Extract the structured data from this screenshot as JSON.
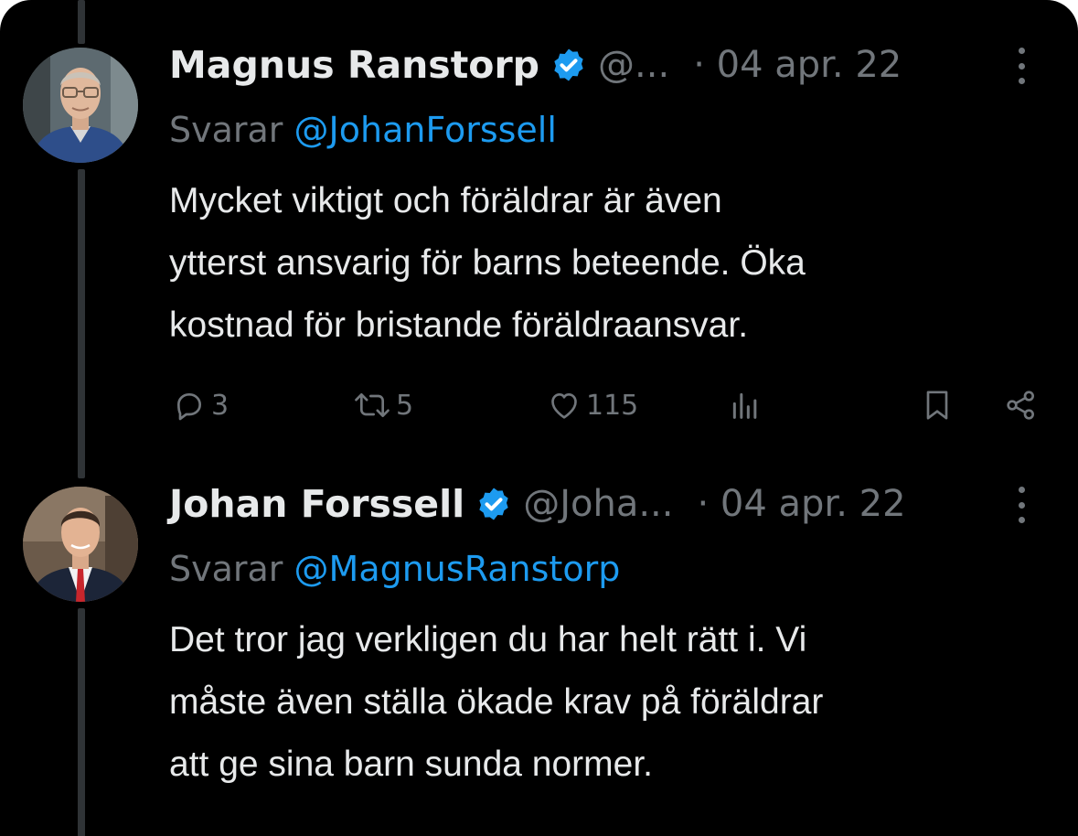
{
  "thread": [
    {
      "name": "Magnus Ranstorp",
      "handle": "@...",
      "date": "· 04 apr. 22",
      "reply_prefix": "Svarar",
      "reply_to": "@JohanForssell",
      "text_lines": [
        "Mycket viktigt och föräldrar är även",
        "ytterst ansvarig för barns beteende. Öka",
        "kostnad för bristande föräldraansvar."
      ],
      "replies": "3",
      "retweets": "5",
      "likes": "115"
    },
    {
      "name": "Johan Forssell",
      "handle": "@Joha...",
      "date": "· 04 apr. 22",
      "reply_prefix": "Svarar",
      "reply_to": "@MagnusRanstorp",
      "text_lines": [
        "Det tror jag verkligen du har helt rätt i. Vi",
        "måste även ställa ökade krav på föräldrar",
        "att ge sina barn sunda normer."
      ]
    }
  ],
  "icons": [
    "verified-badge-icon",
    "more-icon",
    "reply-icon",
    "retweet-icon",
    "like-icon",
    "views-icon",
    "bookmark-icon",
    "share-icon"
  ],
  "colors": {
    "background": "#000000",
    "text": "#e7e9ea",
    "muted": "#71767b",
    "accent": "#1d9bf0"
  }
}
